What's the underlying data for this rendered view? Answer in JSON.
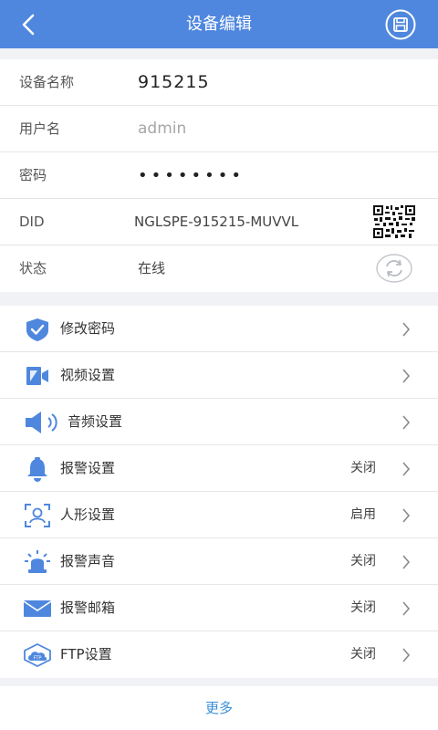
{
  "header": {
    "title": "设备编辑",
    "back_icon": "back-arrow-icon",
    "save_icon": "save-icon",
    "color": "#4f87de"
  },
  "info": {
    "name": {
      "label": "设备名称",
      "value": "915215"
    },
    "username": {
      "label": "用户名",
      "value": "admin"
    },
    "password": {
      "label": "密码",
      "value": "••••••••"
    },
    "did": {
      "label": "DID",
      "value": "NGLSPE-915215-MUVVL",
      "icon": "qr-code-icon"
    },
    "status": {
      "label": "状态",
      "value": "在线",
      "icon": "refresh-icon"
    }
  },
  "menu": [
    {
      "label": "修改密码",
      "status": "",
      "icon": "shield-check-icon"
    },
    {
      "label": "视频设置",
      "status": "",
      "icon": "video-icon"
    },
    {
      "label": "音频设置",
      "status": "",
      "icon": "speaker-icon"
    },
    {
      "label": "报警设置",
      "status": "关闭",
      "icon": "bell-icon"
    },
    {
      "label": "人形设置",
      "status": "启用",
      "icon": "person-frame-icon"
    },
    {
      "label": "报警声音",
      "status": "关闭",
      "icon": "alarm-light-icon"
    },
    {
      "label": "报警邮箱",
      "status": "关闭",
      "icon": "mail-icon"
    },
    {
      "label": "FTP设置",
      "status": "关闭",
      "icon": "ftp-cloud-icon"
    }
  ],
  "footer": {
    "more_label": "更多",
    "color": "#3a8fd8"
  },
  "accent": "#4f87de"
}
